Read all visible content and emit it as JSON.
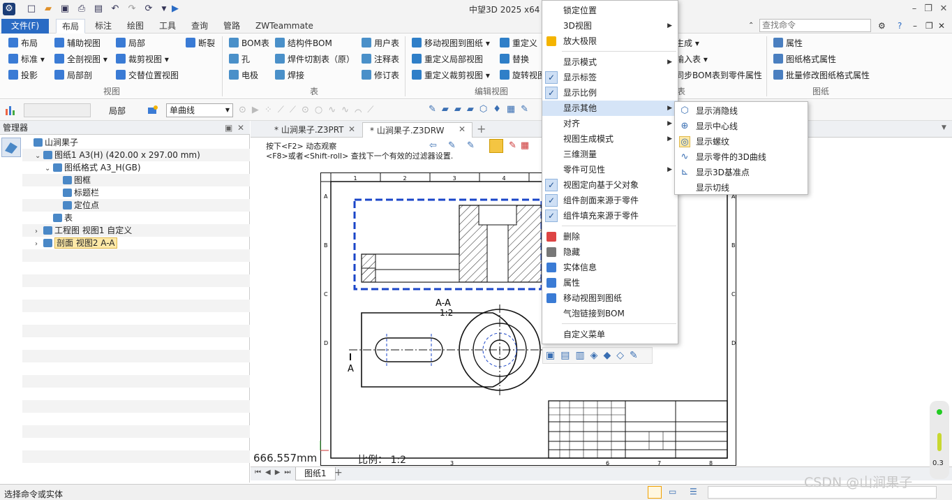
{
  "app": {
    "title": "中望3D 2025 x64 - [",
    "search_placeholder": "查找命令"
  },
  "menu_tabs": [
    "文件(F)",
    "布局",
    "标注",
    "绘图",
    "工具",
    "查询",
    "管路",
    "ZWTeammate"
  ],
  "ribbon": {
    "view_group": {
      "label": "视图",
      "items": [
        "布局",
        "辅助视图",
        "局部",
        "断裂",
        "标准",
        "全剖视图",
        "裁剪视图",
        "投影",
        "局部剖",
        "交替位置视图"
      ]
    },
    "table_group": {
      "label": "表",
      "items": [
        "BOM表",
        "结构件BOM",
        "用户表",
        "孔",
        "焊件切割表（原）",
        "注释表",
        "电极",
        "焊接",
        "修订表"
      ]
    },
    "edit_group": {
      "label": "编辑视图",
      "items": [
        "移动视图到图纸",
        "重定义",
        "重定义局部视图",
        "替换",
        "重定义裁剪视图",
        "旋转视图"
      ]
    },
    "bom_group": {
      "label": "表",
      "items": [
        "生成",
        "输入表",
        "同步BOM表到零件属性"
      ]
    },
    "sheet_group": {
      "label": "图纸",
      "items": [
        "属性",
        "图纸格式属性",
        "批量修改图纸格式属性"
      ]
    }
  },
  "toolbar2": {
    "local_label": "局部",
    "linetype": "单曲线"
  },
  "manager": {
    "title": "管理器",
    "tree": [
      {
        "label": "山涧果子",
        "indent": 0,
        "expander": ""
      },
      {
        "label": "图纸1 A3(H) (420.00 x 297.00 mm)",
        "indent": 1,
        "expander": "v"
      },
      {
        "label": "图纸格式 A3_H(GB)",
        "indent": 2,
        "expander": "v"
      },
      {
        "label": "图框",
        "indent": 3,
        "expander": ""
      },
      {
        "label": "标题栏",
        "indent": 3,
        "expander": ""
      },
      {
        "label": "定位点",
        "indent": 3,
        "expander": ""
      },
      {
        "label": "表",
        "indent": 2,
        "expander": ""
      },
      {
        "label": "工程图 视图1 自定义",
        "indent": 1,
        "expander": ">"
      },
      {
        "label": "剖面 视图2 A-A",
        "indent": 1,
        "expander": ">",
        "selected": true
      }
    ]
  },
  "doc_tabs": [
    {
      "label": "* 山涧果子.Z3PRT",
      "active": false
    },
    {
      "label": "* 山涧果子.Z3DRW",
      "active": true
    }
  ],
  "hints": {
    "line1": "按下<F2> 动态观察",
    "line2": "<F8>或者<Shift-roll> 查找下一个有效的过滤器设置."
  },
  "drawing": {
    "section_label": "A-A",
    "scale_label": "1:2",
    "cut_label_left": "A",
    "col_labels": [
      "1",
      "2",
      "3",
      "4",
      "5",
      "6",
      "7",
      "8"
    ],
    "row_labels": [
      "A",
      "B",
      "C",
      "D"
    ],
    "bottom_cols": [
      "3",
      "6",
      "7",
      "8"
    ]
  },
  "readout": {
    "length": "666.557mm",
    "scale_prefix": "比例：",
    "scale_value": "1:2"
  },
  "sheet_tab": "图纸1",
  "status": {
    "prompt": "选择命令或实体"
  },
  "context_menu": {
    "items": [
      {
        "label": "锁定位置",
        "type": "item"
      },
      {
        "label": "3D视图",
        "type": "submenu"
      },
      {
        "label": "放大极限",
        "type": "item",
        "icon": "sun-icon"
      },
      {
        "type": "sep"
      },
      {
        "label": "显示模式",
        "type": "submenu"
      },
      {
        "label": "显示标签",
        "type": "check"
      },
      {
        "label": "显示比例",
        "type": "check"
      },
      {
        "label": "显示其他",
        "type": "submenu",
        "highlight": true
      },
      {
        "label": "对齐",
        "type": "submenu"
      },
      {
        "label": "视图生成模式",
        "type": "submenu"
      },
      {
        "label": "三维测量",
        "type": "item"
      },
      {
        "label": "零件可见性",
        "type": "submenu"
      },
      {
        "label": "视图定向基于父对象",
        "type": "check"
      },
      {
        "label": "组件剖面来源于零件",
        "type": "check"
      },
      {
        "label": "组件填充来源于零件",
        "type": "check"
      },
      {
        "type": "sep"
      },
      {
        "label": "删除",
        "type": "item",
        "icon": "eraser-icon"
      },
      {
        "label": "隐藏",
        "type": "item",
        "icon": "hide-icon"
      },
      {
        "label": "实体信息",
        "type": "item",
        "icon": "info-icon"
      },
      {
        "label": "属性",
        "type": "item",
        "icon": "properties-icon"
      },
      {
        "label": "移动视图到图纸",
        "type": "item",
        "icon": "move-view-icon"
      },
      {
        "label": "气泡链接到BOM",
        "type": "item"
      },
      {
        "type": "sep"
      },
      {
        "label": "自定义菜单",
        "type": "item"
      }
    ]
  },
  "submenu": {
    "items": [
      {
        "label": "显示消隐线",
        "icon": "hidden-line-icon"
      },
      {
        "label": "显示中心线",
        "icon": "center-line-icon"
      },
      {
        "label": "显示螺纹",
        "icon": "thread-icon",
        "active": true
      },
      {
        "label": "显示零件的3D曲线",
        "icon": "curve-icon"
      },
      {
        "label": "显示3D基准点",
        "icon": "datum-icon"
      },
      {
        "label": "显示切线",
        "icon": ""
      }
    ]
  },
  "watermark": "CSDN @山涧果子",
  "gauge": {
    "value": "0.3"
  },
  "colors": {
    "accent": "#2a6bc4",
    "selection_dash": "#1a45c8",
    "menu_highlight": "#d5e4f7"
  }
}
